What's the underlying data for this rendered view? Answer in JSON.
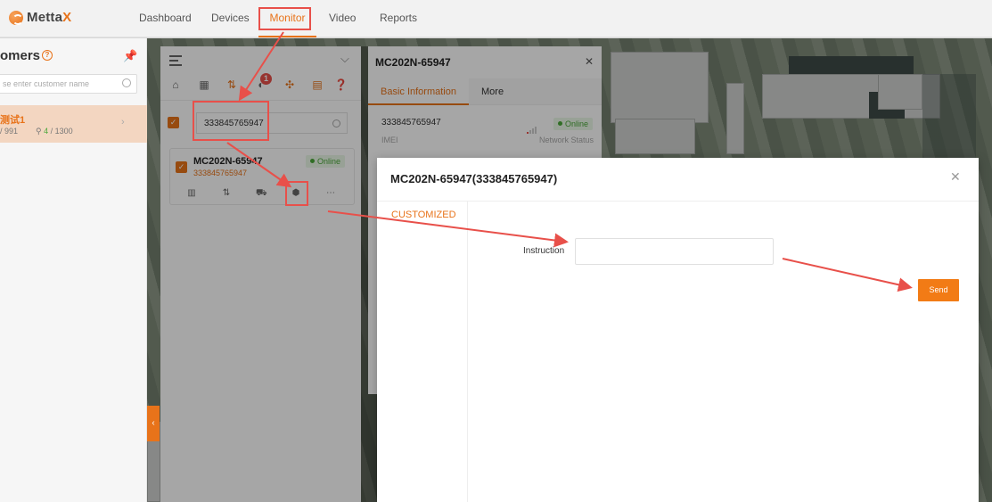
{
  "app": {
    "logo_text_a": "Metta",
    "logo_text_b": "X"
  },
  "nav": [
    {
      "label": "Dashboard"
    },
    {
      "label": "Devices"
    },
    {
      "label": "Monitor"
    },
    {
      "label": "Video"
    },
    {
      "label": "Reports"
    }
  ],
  "customers": {
    "title": "omers",
    "search_placeholder": "se enter customer name",
    "item": {
      "name": "测试1",
      "stats_a": "/ 991",
      "stats_b_online": "4",
      "stats_b_total": "/ 1300"
    }
  },
  "device_panel": {
    "search_value": "333845765947",
    "alarm_count": "1",
    "device": {
      "name": "MC202N-65947",
      "imei": "333845765947",
      "status": "Online"
    }
  },
  "info_panel": {
    "title": "MC202N-65947",
    "tabs": [
      "Basic Information",
      "More"
    ],
    "imei_value": "333845765947",
    "imei_label": "IMEI",
    "status": "Online",
    "network_label": "Network Status"
  },
  "modal": {
    "title": "MC202N-65947(333845765947)",
    "nav_item": "CUSTOMIZED",
    "instruction_label": "Instruction",
    "instruction_value": "",
    "send_label": "Send"
  },
  "colors": {
    "accent": "#e8731a",
    "annotation": "#e8504a",
    "online": "#4aa83a"
  }
}
